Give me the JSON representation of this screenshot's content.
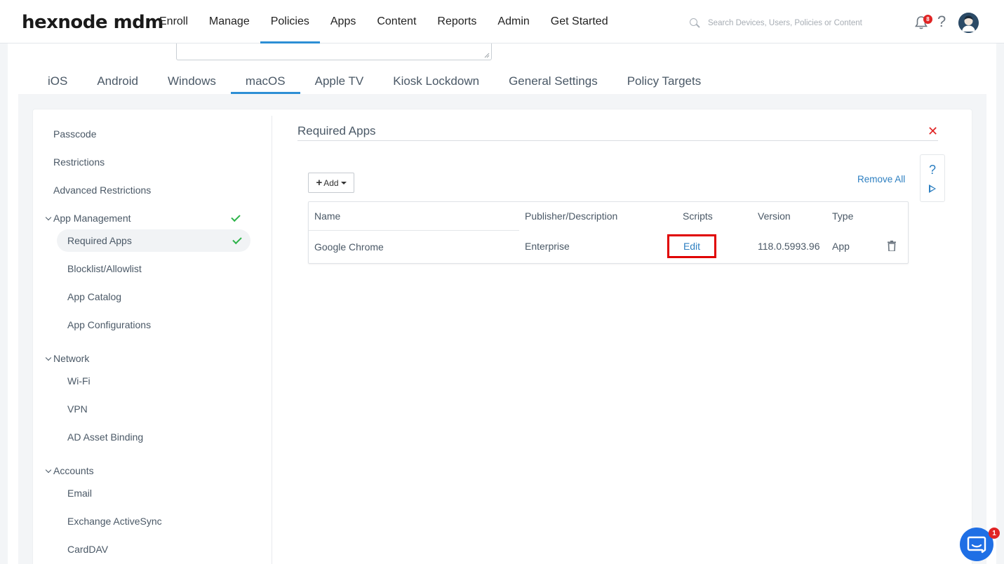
{
  "header": {
    "logo": "hexnode mdm",
    "nav": [
      "Enroll",
      "Manage",
      "Policies",
      "Apps",
      "Content",
      "Reports",
      "Admin",
      "Get Started"
    ],
    "active_nav": "Policies",
    "search_placeholder": "Search Devices, Users, Policies or Content",
    "notification_count": "8",
    "help_label": "?",
    "icons": [
      "search-icon",
      "bell-icon",
      "help-icon",
      "avatar"
    ]
  },
  "os_tabs": [
    "iOS",
    "Android",
    "Windows",
    "macOS",
    "Apple TV",
    "Kiosk Lockdown",
    "General Settings",
    "Policy Targets"
  ],
  "active_os_tab": "macOS",
  "sidebar": {
    "items": {
      "passcode": "Passcode",
      "restrictions": "Restrictions",
      "advanced_restrictions": "Advanced Restrictions",
      "app_management": "App Management",
      "required_apps": "Required Apps",
      "blocklist": "Blocklist/Allowlist",
      "app_catalog": "App Catalog",
      "app_configurations": "App Configurations",
      "network": "Network",
      "wifi": "Wi-Fi",
      "vpn": "VPN",
      "ad_asset_binding": "AD Asset Binding",
      "accounts": "Accounts",
      "email": "Email",
      "exchange": "Exchange ActiveSync",
      "carddav": "CardDAV"
    },
    "active_item": "Required Apps"
  },
  "main": {
    "title": "Required Apps",
    "add_label": "Add",
    "remove_all_label": "Remove All",
    "help_label": "?",
    "table": {
      "columns": [
        "Name",
        "Publisher/Description",
        "Scripts",
        "Version",
        "Type"
      ],
      "rows": [
        {
          "name": "Google Chrome",
          "publisher": "Enterprise",
          "scripts": "Edit",
          "version": "118.0.5993.96",
          "type": "App"
        }
      ]
    }
  },
  "chat": {
    "badge": "1"
  },
  "colors": {
    "accent": "#2d8fd5",
    "link": "#2d7fc1",
    "check": "#2db34a",
    "close": "#e02424",
    "highlight_box": "#e00000",
    "chat": "#1f6fe5"
  }
}
